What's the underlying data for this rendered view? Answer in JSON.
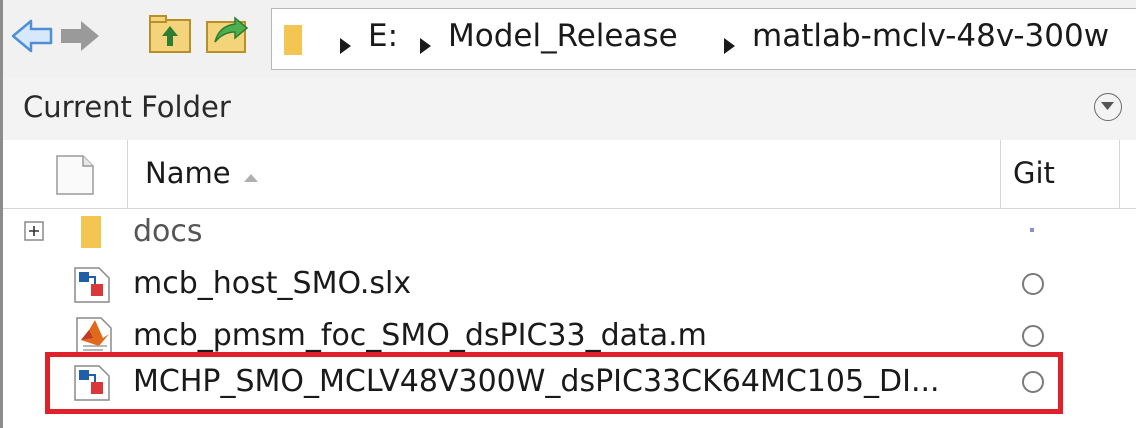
{
  "toolbar": {
    "breadcrumb": [
      "E:",
      "Model_Release",
      "matlab-mclv-48v-300w"
    ],
    "icons": [
      "back-arrow-icon",
      "forward-arrow-icon",
      "up-folder-icon",
      "browse-folder-icon",
      "folder-icon"
    ]
  },
  "panel": {
    "title": "Current Folder"
  },
  "columns": {
    "name": "Name",
    "git": "Git"
  },
  "files": [
    {
      "name": "docs",
      "type": "folder",
      "git": "dot"
    },
    {
      "name": "mcb_host_SMO.slx",
      "type": "simulink",
      "git": "circle"
    },
    {
      "name": "mcb_pmsm_foc_SMO_dsPIC33_data.m",
      "type": "matlab-script",
      "git": "circle"
    },
    {
      "name": "MCHP_SMO_MCLV48V300W_dsPIC33CK64MC105_DI...",
      "type": "simulink",
      "git": "circle"
    }
  ],
  "colors": {
    "highlight": "#e0202a",
    "folder": "#f3c553",
    "nav_arrow": "#4f8fd6"
  }
}
